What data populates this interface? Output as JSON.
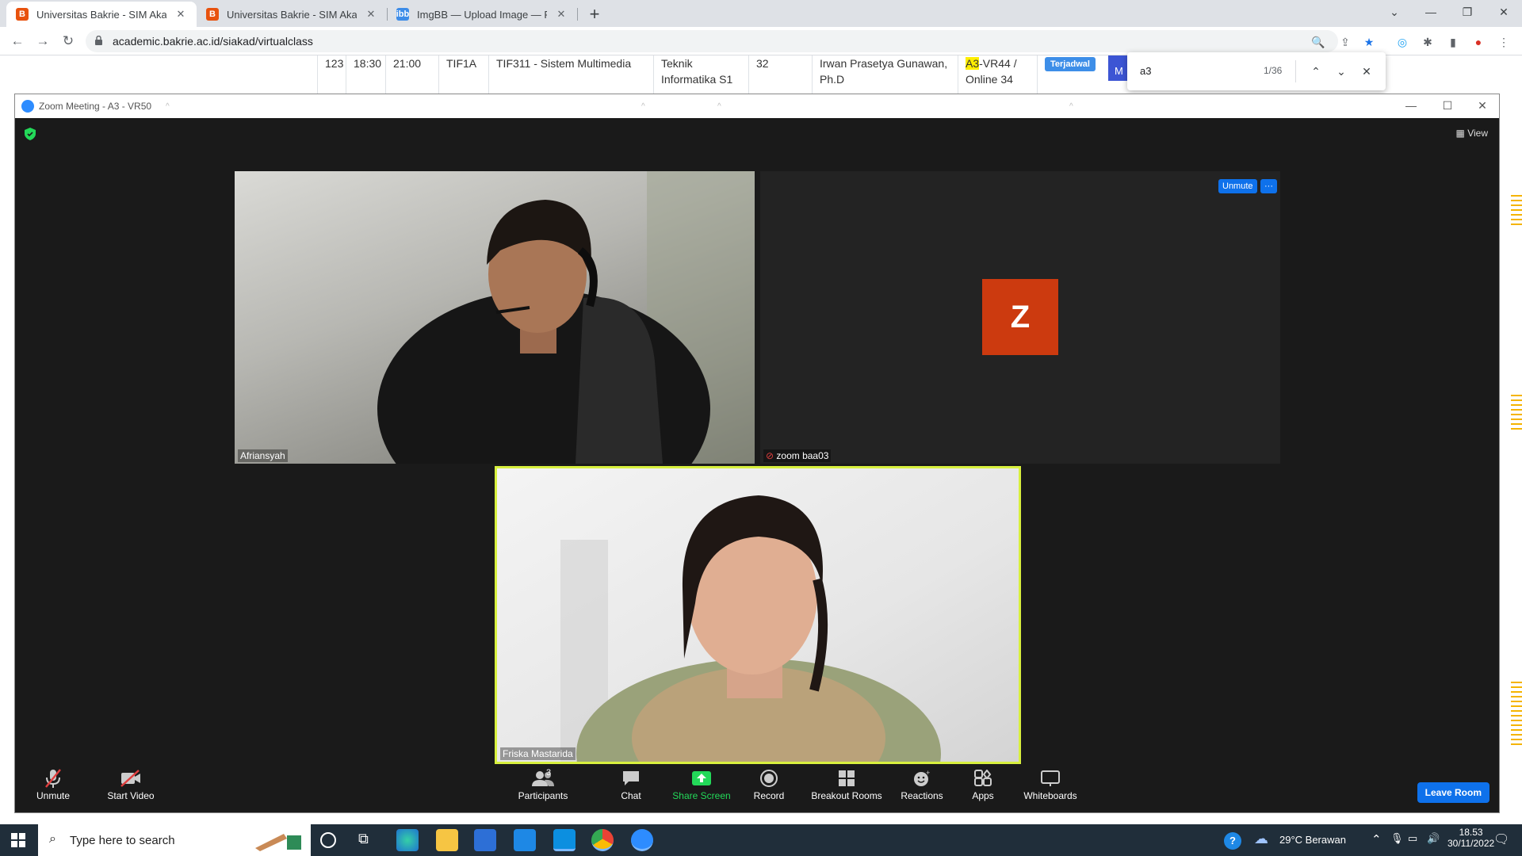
{
  "browser": {
    "tabs": [
      {
        "title": "Universitas Bakrie - SIM Akademik",
        "favicon": "B",
        "active": true
      },
      {
        "title": "Universitas Bakrie - SIM Akademik",
        "favicon": "B",
        "active": false
      },
      {
        "title": "ImgBB — Upload Image — Free Image Hosting",
        "favicon": "ibb",
        "active": false
      }
    ],
    "url": "academic.bakrie.ac.id/siakad/virtualclass",
    "find": {
      "query": "a3",
      "count": "1/36"
    }
  },
  "page": {
    "row": {
      "no": "123",
      "start": "18:30",
      "end": "21:00",
      "class": "TIF1A",
      "course": "TIF311 - Sistem Multimedia",
      "program": "Teknik Informatika S1",
      "capacity": "32",
      "lecturer": "Irwan Prasetya Gunawan, Ph.D",
      "room_highlight": "A3",
      "room_rest": "-VR44 / Online 34",
      "status": "Terjadwal",
      "button": "M"
    }
  },
  "zoom": {
    "window_title": "Zoom Meeting - A3 - VR50",
    "view_label": "View",
    "participants": [
      {
        "name": "Afriansyah",
        "video": true
      },
      {
        "name": "zoom baa03",
        "video": false,
        "initial": "Z",
        "muted": true,
        "avatar_color": "#cc3a0f"
      },
      {
        "name": "Friska Mastarida",
        "video": true,
        "active_speaker": true
      }
    ],
    "tile_actions": {
      "unmute": "Unmute",
      "more": "···"
    },
    "controls": {
      "unmute": "Unmute",
      "start_video": "Start Video",
      "participants": "Participants",
      "participant_count": "3",
      "chat": "Chat",
      "share_screen": "Share Screen",
      "record": "Record",
      "breakout": "Breakout Rooms",
      "reactions": "Reactions",
      "apps": "Apps",
      "whiteboards": "Whiteboards",
      "leave": "Leave Room"
    },
    "accent": "#0e71eb",
    "share_color": "#23d959"
  },
  "taskbar": {
    "search_placeholder": "Type here to search",
    "weather": "29°C  Berawan",
    "time": "18.53",
    "date": "30/11/2022"
  }
}
